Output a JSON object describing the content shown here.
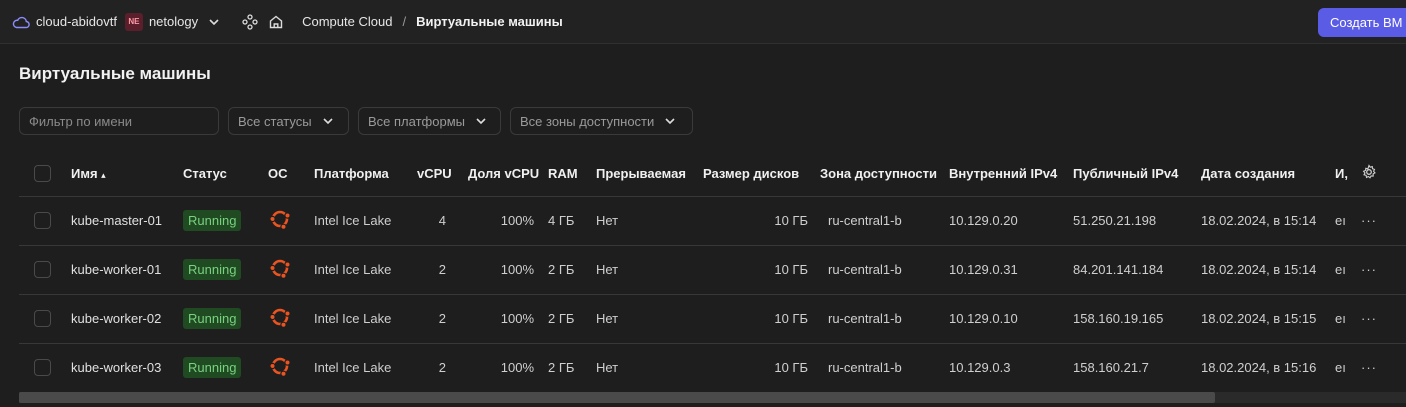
{
  "topbar": {
    "cloud_name": "cloud-abidovtf",
    "org_badge": "NE",
    "org_name": "netology",
    "crumb_service": "Compute Cloud",
    "crumb_separator": "/",
    "crumb_current": "Виртуальные машины",
    "create_button": "Создать ВМ"
  },
  "page": {
    "title": "Виртуальные машины"
  },
  "filters": {
    "name_placeholder": "Фильтр по имени",
    "status_select": "Все статусы",
    "platform_select": "Все платформы",
    "zone_select": "Все зоны доступности"
  },
  "table": {
    "columns": {
      "name": "Имя",
      "name_sort": "▴",
      "status": "Статус",
      "os": "ОС",
      "platform": "Платформа",
      "vcpu": "vCPU",
      "vcpu_share": "Доля vCPU",
      "ram": "RAM",
      "preemptible": "Прерываемая",
      "disk_size": "Размер дисков",
      "zone": "Зона доступности",
      "internal_ip": "Внутренний IPv4",
      "public_ip": "Публичный IPv4",
      "created": "Дата создания",
      "id": "И,"
    },
    "rows": [
      {
        "name": "kube-master-01",
        "status": "Running",
        "platform": "Intel Ice Lake",
        "vcpu": "4",
        "vcpu_share": "100%",
        "ram": "4 ГБ",
        "preemptible": "Нет",
        "disk_size": "10 ГБ",
        "zone": "ru-central1-b",
        "internal_ip": "10.129.0.20",
        "public_ip": "51.250.21.198",
        "created": "18.02.2024, в 15:14",
        "id": "eı"
      },
      {
        "name": "kube-worker-01",
        "status": "Running",
        "platform": "Intel Ice Lake",
        "vcpu": "2",
        "vcpu_share": "100%",
        "ram": "2 ГБ",
        "preemptible": "Нет",
        "disk_size": "10 ГБ",
        "zone": "ru-central1-b",
        "internal_ip": "10.129.0.31",
        "public_ip": "84.201.141.184",
        "created": "18.02.2024, в 15:14",
        "id": "eı"
      },
      {
        "name": "kube-worker-02",
        "status": "Running",
        "platform": "Intel Ice Lake",
        "vcpu": "2",
        "vcpu_share": "100%",
        "ram": "2 ГБ",
        "preemptible": "Нет",
        "disk_size": "10 ГБ",
        "zone": "ru-central1-b",
        "internal_ip": "10.129.0.10",
        "public_ip": "158.160.19.165",
        "created": "18.02.2024, в 15:15",
        "id": "eı"
      },
      {
        "name": "kube-worker-03",
        "status": "Running",
        "platform": "Intel Ice Lake",
        "vcpu": "2",
        "vcpu_share": "100%",
        "ram": "2 ГБ",
        "preemptible": "Нет",
        "disk_size": "10 ГБ",
        "zone": "ru-central1-b",
        "internal_ip": "10.129.0.3",
        "public_ip": "158.160.21.7",
        "created": "18.02.2024, в 15:16",
        "id": "eı"
      }
    ],
    "row_menu": "···"
  },
  "icons": {
    "cloud": "cloud-icon",
    "services": "services-icon",
    "home": "home-icon",
    "settings": "gear-icon",
    "os": "ubuntu-icon"
  },
  "colors": {
    "accent": "#5b5ce6",
    "running_bg": "#1f4a22",
    "running_text": "#79d17f",
    "ubuntu": "#e95420"
  }
}
